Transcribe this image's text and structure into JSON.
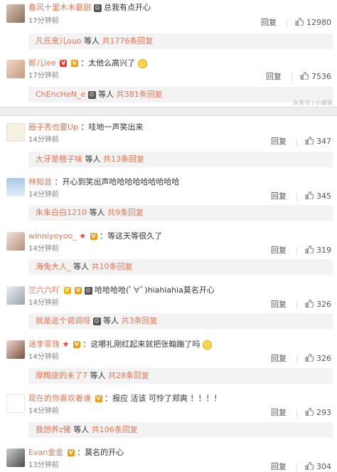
{
  "watermark": "头条号 / 小顺哥",
  "top_comments": [
    {
      "user": "春风十里木木最甜",
      "content": "总我有点开心",
      "time": "17分钟前",
      "reply": "回复",
      "likes": "12980",
      "sub": {
        "user": "凡氏宠儿ouo",
        "etc": "等人",
        "total": "共1776条回复"
      }
    },
    {
      "user": "郎儿lee",
      "content": "：太他么高兴了",
      "time": "17分钟前",
      "reply": "回复",
      "likes": "7536",
      "sub": {
        "user": "ChEncHeN_e",
        "etc": "等人",
        "total": "共381条回复"
      }
    }
  ],
  "comments": [
    {
      "user": "圈子秀也要Up",
      "content": "：哇地一声笑出来",
      "time": "14分钟前",
      "reply": "回复",
      "likes": "347",
      "sub": {
        "user": "大牙是橙子味",
        "etc": "等人",
        "total": "共13条回复"
      }
    },
    {
      "user": "林知音",
      "content": "：开心到笑出声哈哈哈哈哈哈哈哈哈",
      "time": "14分钟前",
      "reply": "回复",
      "likes": "345",
      "sub": {
        "user": "朱朱白白1210",
        "etc": "等人",
        "total": "共9条回复"
      }
    },
    {
      "user": "winniyoyoo_",
      "content": "：等这天等很久了",
      "time": "14分钟前",
      "reply": "回复",
      "likes": "319",
      "sub": {
        "user": "海兔大人_",
        "etc": "等人",
        "total": "共10条回复"
      }
    },
    {
      "user": "兰六六吖",
      "content": "哈哈哈哈(ﾟ∀ﾟ)hiahiahia莫名开心",
      "time": "14分钟前",
      "reply": "回复",
      "likes": "326",
      "sub": {
        "user": "就是这个调调呀",
        "etc": "等人",
        "total": "共3条回复"
      }
    },
    {
      "user": "迷李菲珠",
      "content": "：这哪扎刚红起来就把张翰踹了吗",
      "time": "14分钟前",
      "reply": "回复",
      "likes": "326",
      "sub": {
        "user": "摩羯座的未了7",
        "etc": "等人",
        "total": "共28条回复"
      }
    },
    {
      "user": "现在的你喜欢着谁",
      "content": "：报应 活该 可怜了郑爽 ！！！！",
      "time": "14分钟前",
      "reply": "回复",
      "likes": "293",
      "sub": {
        "user": "我想养z猪",
        "etc": "等人",
        "total": "共106条回复"
      }
    },
    {
      "user": "Evan金金",
      "content": "：莫名的开心",
      "time": "13分钟前",
      "reply": "回复",
      "likes": "304"
    }
  ]
}
